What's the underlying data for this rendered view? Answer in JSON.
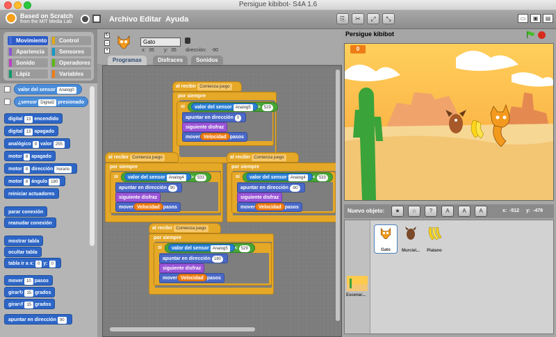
{
  "window": {
    "title": "Persigue kibibot- S4A 1.6"
  },
  "menubar": {
    "brand_line1": "Based on Scratch",
    "brand_line2": "from the MIT Media Lab",
    "menus": [
      "Archivo",
      "Editar",
      "Ayuda"
    ]
  },
  "categories": [
    {
      "label": "Movimiento",
      "color": "#4a6cd4"
    },
    {
      "label": "Control",
      "color": "#e1a91a"
    },
    {
      "label": "Apariencia",
      "color": "#8a55d7"
    },
    {
      "label": "Sensores",
      "color": "#0e9acb"
    },
    {
      "label": "Sonido",
      "color": "#bb42c3"
    },
    {
      "label": "Operadores",
      "color": "#5cb712"
    },
    {
      "label": "Lápiz",
      "color": "#0e9a6c"
    },
    {
      "label": "Variables",
      "color": "#ee7d16"
    }
  ],
  "palette": {
    "sensor_value": {
      "label": "valor del sensor",
      "drop": "Analog0"
    },
    "sensor_pressed": {
      "label": "¿sensor",
      "drop": "Digital2",
      "suffix": "presionado"
    },
    "digital_on": {
      "label": "digital",
      "val": "13",
      "suffix": "encendido"
    },
    "digital_off": {
      "label": "digital",
      "val": "13",
      "suffix": "apagado"
    },
    "analog": {
      "label": "analógico",
      "val": "9",
      "mid": "valor",
      "val2": "255"
    },
    "motor_off": {
      "label": "motor",
      "val": "8",
      "suffix": "apagado"
    },
    "motor_dir": {
      "label": "motor",
      "val": "8",
      "mid": "dirección",
      "drop": "horario"
    },
    "motor_angle": {
      "label": "motor",
      "val": "8",
      "mid": "ángulo",
      "val2": "180"
    },
    "reset": {
      "label": "reiniciar actuadores"
    },
    "stop_conn": {
      "label": "parar conexión"
    },
    "resume_conn": {
      "label": "reanudar conexión"
    },
    "show_table": {
      "label": "mostrar tabla"
    },
    "hide_table": {
      "label": "ocultar tabla"
    },
    "table_go": {
      "label": "tabla ir a x:",
      "x": "0",
      "y_label": "y:",
      "y": "0"
    },
    "move": {
      "label": "mover",
      "val": "10",
      "suffix": "pasos"
    },
    "turn_cw": {
      "label": "girar",
      "glyph": "↻",
      "val": "15",
      "suffix": "grados"
    },
    "turn_ccw": {
      "label": "girar",
      "glyph": "↺",
      "val": "15",
      "suffix": "grados"
    },
    "point_dir": {
      "label": "apuntar en dirección",
      "val": "90"
    }
  },
  "sprite": {
    "name": "Gato",
    "x_label": "x:",
    "x": "35",
    "y_label": "y:",
    "y": "35",
    "dir_label": "dirección:",
    "dir": "-90"
  },
  "tabs": [
    "Programas",
    "Disfraces",
    "Sonidos"
  ],
  "scripts": {
    "when_label": "al recibir",
    "event": "Comienza juego",
    "forever": "por siempre",
    "if": "si",
    "sensor": "valor del sensor",
    "point": "apuntar en dirección",
    "next_costume": "siguiente disfraz",
    "move": "mover",
    "var": "Velocidad",
    "steps": "pasos",
    "s1": {
      "sensor": "Analog5",
      "op": ">",
      "value": "529",
      "dir": "0"
    },
    "s2": {
      "sensor": "Analog4",
      "op": ">",
      "value": "533",
      "dir": "90"
    },
    "s3": {
      "sensor": "Analog4",
      "op": "<",
      "value": "533",
      "dir": "-90"
    },
    "s4": {
      "sensor": "Analog5",
      "op": "<",
      "value": "529",
      "dir": "180"
    }
  },
  "stage": {
    "title": "Persigue kibibot",
    "counter": "0",
    "new_object_label": "Nuevo objeto:",
    "mouse_x_label": "x:",
    "mouse_x": "-512",
    "mouse_y_label": "y:",
    "mouse_y": "-479"
  },
  "sprites": [
    {
      "label": "Gato"
    },
    {
      "label": "Murciel..."
    },
    {
      "label": "Platano"
    }
  ],
  "stage_thumb_label": "Escenar..."
}
